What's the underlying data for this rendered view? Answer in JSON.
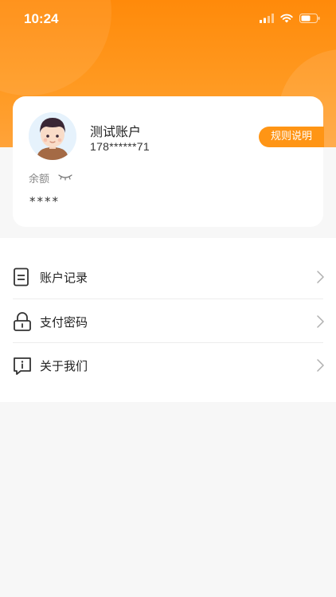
{
  "status_bar": {
    "time": "10:24"
  },
  "profile": {
    "username": "测试账户",
    "phone": "178******71",
    "rules_button_label": "规则说明",
    "balance_label": "余额",
    "balance_value": "****"
  },
  "menu": {
    "items": [
      {
        "label": "账户记录",
        "icon": "document-icon"
      },
      {
        "label": "支付密码",
        "icon": "lock-icon"
      },
      {
        "label": "关于我们",
        "icon": "info-chat-icon"
      }
    ]
  },
  "colors": {
    "accent": "#ff9515",
    "header": "#ff8a0a"
  }
}
